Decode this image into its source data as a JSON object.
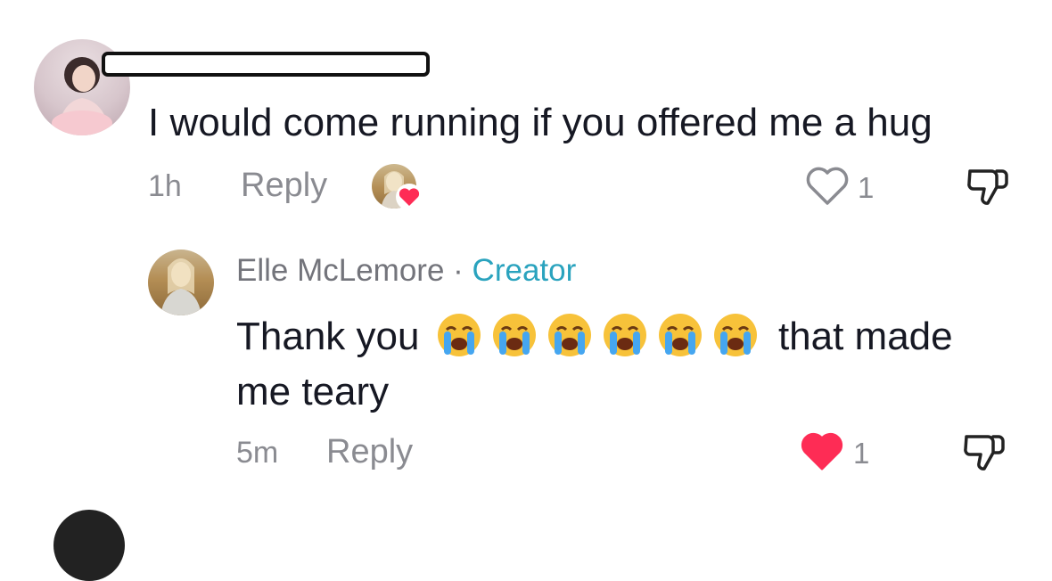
{
  "comment": {
    "text": "I would come running if you offered me a hug",
    "time": "1h",
    "reply_label": "Reply",
    "like_count": "1",
    "liked": false
  },
  "reply": {
    "author": "Elle McLemore",
    "separator": "·",
    "badge": "Creator",
    "text_before": "Thank you",
    "emojis": [
      "loudly-crying-face",
      "loudly-crying-face",
      "loudly-crying-face",
      "loudly-crying-face",
      "loudly-crying-face",
      "loudly-crying-face"
    ],
    "text_after": "that made",
    "text_line2": "me teary",
    "time": "5m",
    "reply_label": "Reply",
    "like_count": "1",
    "liked": true
  },
  "colors": {
    "like_red": "#fe2c55",
    "creator_blue": "#2aa3be",
    "muted": "#8a8b91"
  }
}
